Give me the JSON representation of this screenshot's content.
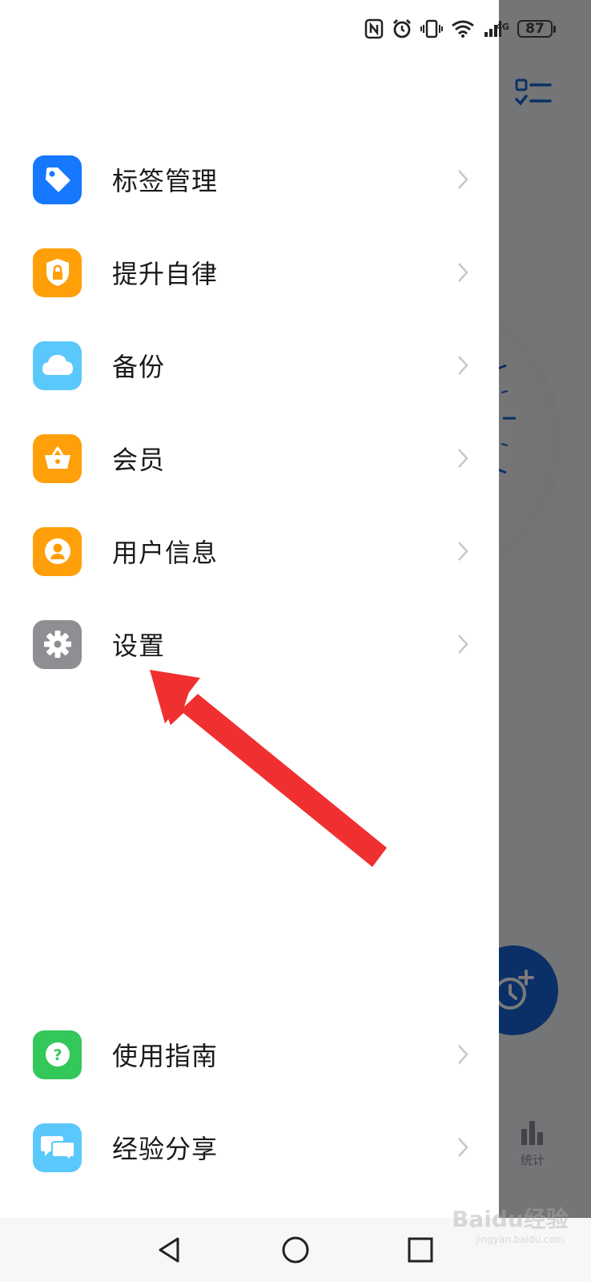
{
  "status_bar": {
    "network": "4G",
    "battery": "87"
  },
  "menu": {
    "items": [
      {
        "label": "标签管理",
        "icon": "tag-icon",
        "color": "#1677ff"
      },
      {
        "label": "提升自律",
        "icon": "shield-lock-icon",
        "color": "#ff9f0a"
      },
      {
        "label": "备份",
        "icon": "cloud-icon",
        "color": "#5ac8fa"
      },
      {
        "label": "会员",
        "icon": "basket-icon",
        "color": "#ff9f0a"
      },
      {
        "label": "用户信息",
        "icon": "user-icon",
        "color": "#ff9f0a"
      },
      {
        "label": "设置",
        "icon": "gear-icon",
        "color": "#8e8e93"
      },
      {
        "label": "使用指南",
        "icon": "question-icon",
        "color": "#34c759"
      },
      {
        "label": "经验分享",
        "icon": "chat-bubbles-icon",
        "color": "#5ac8fa"
      }
    ]
  },
  "background": {
    "stat_label": "统计",
    "fab_color": "#1565d8"
  },
  "watermark": {
    "text": "Baidu经验",
    "sub": "jingyan.baidu.com"
  },
  "annotation": {
    "arrow_color": "#f03030"
  }
}
